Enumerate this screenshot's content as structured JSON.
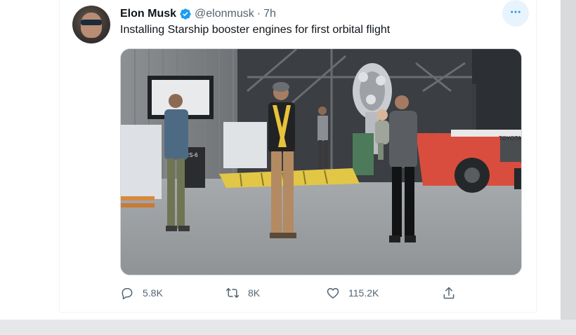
{
  "tweet": {
    "display_name": "Elon Musk",
    "verified": true,
    "handle": "@elonmusk",
    "separator": "·",
    "timestamp": "7h",
    "text": "Installing Starship booster engines for first orbital flight",
    "more_icon": "more-horizontal-icon",
    "media": {
      "equipment_label": "PRS-6",
      "forklift_label": "TOYOTA"
    },
    "actions": {
      "reply": {
        "icon": "reply-icon",
        "count": "5.8K"
      },
      "retweet": {
        "icon": "retweet-icon",
        "count": "8K"
      },
      "like": {
        "icon": "like-icon",
        "count": "115.2K"
      },
      "share": {
        "icon": "share-icon"
      }
    }
  },
  "colors": {
    "accent": "#1d9bf0",
    "text_primary": "#0f1419",
    "text_secondary": "#536471"
  }
}
